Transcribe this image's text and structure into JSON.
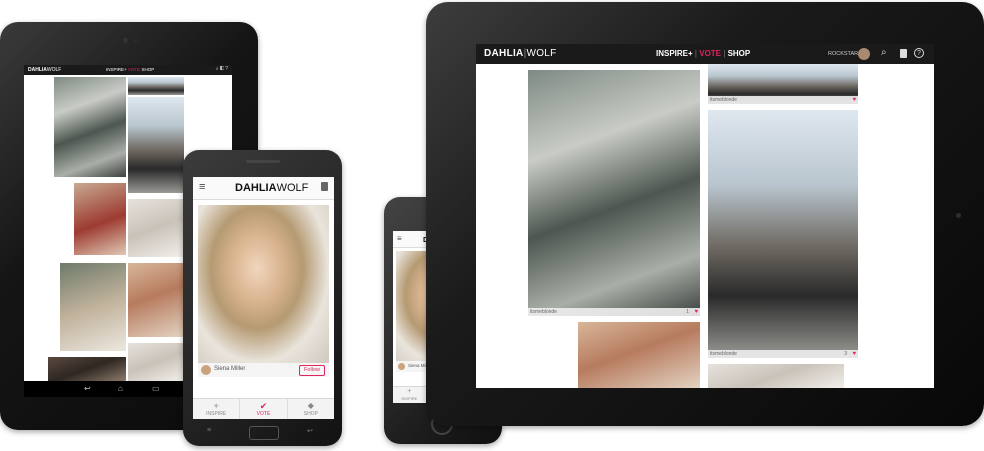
{
  "brand": {
    "logo_left": "DAHLIA",
    "logo_right": "WOLF",
    "accent": "#e0245e"
  },
  "nav": {
    "inspire": "INSPIRE+",
    "vote": "VOTE",
    "shop": "SHOP",
    "user": "ROCKSTAR"
  },
  "ipad": {
    "feed": [
      {
        "caption": "itsmeblonde",
        "likes": "1"
      },
      {
        "caption": "itsmeblonde",
        "likes": "3"
      },
      {
        "caption": "itsmeblonde",
        "likes": ""
      }
    ]
  },
  "phone": {
    "profile_name": "Siena Miller",
    "follow": "Follow",
    "tabs": [
      {
        "label": "INSPIRE",
        "icon": "plus-icon"
      },
      {
        "label": "VOTE",
        "icon": "check-icon"
      },
      {
        "label": "SHOP",
        "icon": "tag-icon"
      }
    ]
  },
  "icons": [
    "search-icon",
    "bag-icon",
    "help-icon",
    "menu-icon",
    "avatar-icon"
  ]
}
